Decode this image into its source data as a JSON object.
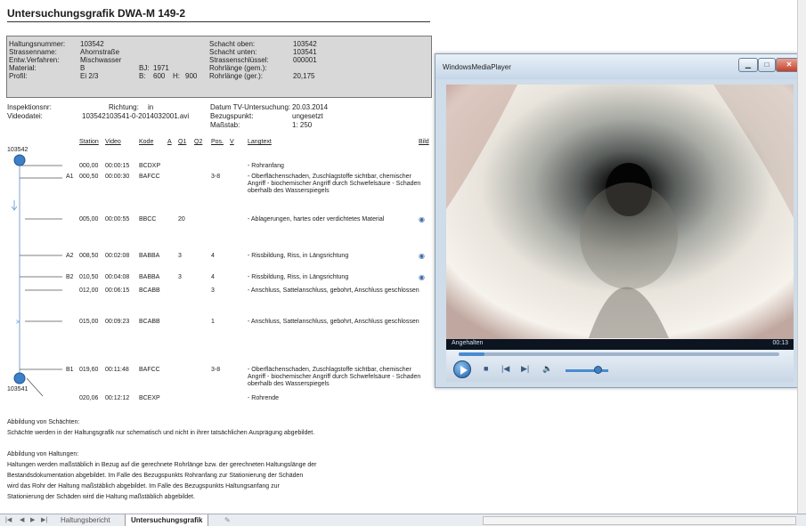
{
  "document": {
    "title": "Untersuchungsgrafik DWA-M 149-2"
  },
  "info": {
    "haltungsnummer_label": "Haltungsnummer:",
    "haltungsnummer": "103542",
    "strassenname_label": "Strassenname:",
    "strassenname": "Ahornstraße",
    "entw_label": "Entw.Verfahren:",
    "entw": "Mischwasser",
    "material_label": "Material:",
    "material": "B",
    "bj_label": "BJ:",
    "bj": "1971",
    "profil_label": "Profil:",
    "profil": "Ei 2/3",
    "b_label": "B:",
    "b": "600",
    "h_label": "H:",
    "h": "900",
    "schacht_oben_label": "Schacht oben:",
    "schacht_oben": "103542",
    "schacht_unten_label": "Schacht unten:",
    "schacht_unten": "103541",
    "strassenschluessel_label": "Strassenschlüssel:",
    "strassenschluessel": "000001",
    "rohrlaenge_gem_label": "Rohrlänge (gem.):",
    "rohrlaenge_gem": "",
    "rohrlaenge_ger_label": "Rohrlänge (ger.):",
    "rohrlaenge_ger": "20,175"
  },
  "inspection": {
    "inspektionsnr_label": "Inspektionsnr:",
    "richtung_label": "Richtung:",
    "richtung": "in",
    "datum_label": "Datum TV-Untersuchung:",
    "datum": "20.03.2014",
    "videodatei_label": "Videodatei:",
    "videodatei": "103542103541-0-2014032001.avi",
    "bezugspunkt_label": "Bezugspunkt:",
    "bezugspunkt": "ungesetzt",
    "massstab_label": "Maßstab:",
    "massstab": "1: 250"
  },
  "table": {
    "headers": {
      "station": "Station",
      "video": "Video",
      "kode": "Kode",
      "a": "A",
      "q1": "Q1",
      "q2": "Q2",
      "pos": "Pos.",
      "v": "V",
      "langtext": "Langtext",
      "bild": "Bild"
    },
    "start_node": "103542",
    "end_node": "103541",
    "rows": [
      {
        "label": "",
        "station": "000,00",
        "video": "00:00:15",
        "kode": "BCDXP",
        "q1": "",
        "pos": "",
        "text": "- Rohranfang",
        "bild": ""
      },
      {
        "label": "A1",
        "station": "000,50",
        "video": "00:00:30",
        "kode": "BAFCC",
        "q1": "",
        "pos": "3-8",
        "text": "- Oberflächenschaden, Zuschlagstoffe sichtbar, chemischer Angriff - biochemischer Angriff durch Schwefelsäure - Schaden oberhalb des Wasserspiegels",
        "bild": ""
      },
      {
        "label": "",
        "station": "005,00",
        "video": "00:00:55",
        "kode": "BBCC",
        "q1": "20",
        "pos": "",
        "text": "- Ablagerungen, hartes oder verdichtetes Material",
        "bild": "◉"
      },
      {
        "label": "A2",
        "station": "008,50",
        "video": "00:02:08",
        "kode": "BABBA",
        "q1": "3",
        "pos": "4",
        "text": "- Rissbildung, Riss, in Längsrichtung",
        "bild": "◉"
      },
      {
        "label": "B2",
        "station": "010,50",
        "video": "00:04:08",
        "kode": "BABBA",
        "q1": "3",
        "pos": "4",
        "text": "- Rissbildung, Riss, in Längsrichtung",
        "bild": "◉"
      },
      {
        "label": "",
        "station": "012,00",
        "video": "00:06:15",
        "kode": "BCABB",
        "q1": "",
        "pos": "3",
        "text": "- Anschluss, Sattelanschluss, gebohrt, Anschluss geschlossen",
        "bild": ""
      },
      {
        "label": "",
        "station": "015,00",
        "video": "00:09:23",
        "kode": "BCABB",
        "q1": "",
        "pos": "1",
        "text": "- Anschluss, Sattelanschluss, gebohrt, Anschluss geschlossen",
        "bild": ""
      },
      {
        "label": "B1",
        "station": "019,60",
        "video": "00:11:48",
        "kode": "BAFCC",
        "q1": "",
        "pos": "3-8",
        "text": "- Oberflächenschaden, Zuschlagstoffe sichtbar, chemischer Angriff - biochemischer Angriff durch Schwefelsäure - Schaden oberhalb des Wasserspiegels",
        "bild": ""
      },
      {
        "label": "",
        "station": "020,06",
        "video": "00:12:12",
        "kode": "BCEXP",
        "q1": "",
        "pos": "",
        "text": "- Rohrende",
        "bild": ""
      }
    ]
  },
  "legend": {
    "schaechte_title": "Abbildung von Schächten:",
    "schaechte_text": "Schächte werden in der Haltungsgrafik nur schematisch und nicht in ihrer tatsächlichen Ausprägung abgebildet.",
    "haltungen_title": "Abbildung von Haltungen:",
    "haltungen_line1": "Haltungen werden maßstäblich in Bezug auf die gerechnete Rohrlänge bzw. der gerechneten Haltungslänge der",
    "haltungen_line2": "Bestandsdokumentation abgebildet. Im Falle des Bezugspunkts Rohranfang zur Stationierung der Schäden",
    "haltungen_line3": "wird das Rohr der Haltung maßstäblich abgebildet. Im Falle des Bezugspunkts Haltungsanfang zur",
    "haltungen_line4": "Stationierung der Schäden wird die Haltung maßstäblich abgebildet."
  },
  "player": {
    "title": "WindowsMediaPlayer",
    "status": "Angehalten",
    "time": "00:13",
    "seek_fraction": 0.08,
    "volume_fraction": 0.75
  },
  "sheet_tabs": [
    "Haltungsbericht",
    "Untersuchungsgrafik"
  ],
  "colors": {
    "accent": "#4a8ad0",
    "node": "#3d80c8"
  }
}
